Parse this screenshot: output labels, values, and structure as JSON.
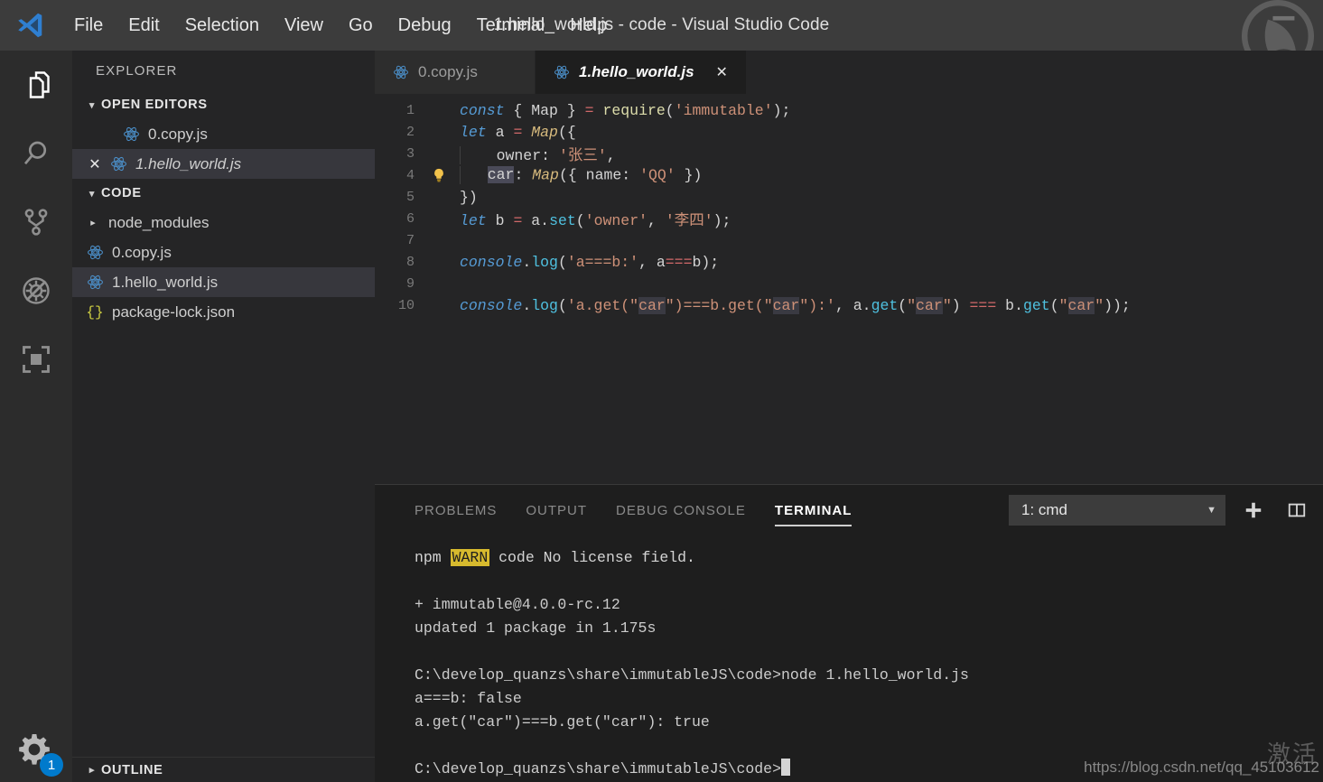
{
  "window": {
    "title": "1.hello_world.js - code - Visual Studio Code",
    "logo_icon": "vscode-logo-icon"
  },
  "menubar": {
    "items": [
      {
        "label": "File"
      },
      {
        "label": "Edit"
      },
      {
        "label": "Selection"
      },
      {
        "label": "View"
      },
      {
        "label": "Go"
      },
      {
        "label": "Debug"
      },
      {
        "label": "Terminal"
      },
      {
        "label": "Help"
      }
    ]
  },
  "activitybar": {
    "items": [
      {
        "name": "explorer",
        "icon": "files-icon",
        "active": true
      },
      {
        "name": "search",
        "icon": "search-icon",
        "active": false
      },
      {
        "name": "source-control",
        "icon": "source-control-icon",
        "active": false
      },
      {
        "name": "debug",
        "icon": "debug-no-icon",
        "active": false
      },
      {
        "name": "extensions",
        "icon": "extensions-icon",
        "active": false
      }
    ],
    "manage": {
      "icon": "gear-icon",
      "badge": "1"
    }
  },
  "sidebar": {
    "title": "EXPLORER",
    "open_editors": {
      "label": "OPEN EDITORS",
      "items": [
        {
          "label": "0.copy.js",
          "icon": "js-file-icon",
          "selected": false,
          "has_close": false,
          "italic": false
        },
        {
          "label": "1.hello_world.js",
          "icon": "js-file-icon",
          "selected": true,
          "has_close": true,
          "italic": true
        }
      ]
    },
    "folder": {
      "label": "CODE",
      "items": [
        {
          "label": "node_modules",
          "icon": "folder-arrow-icon",
          "selected": false,
          "kind": "folder"
        },
        {
          "label": "0.copy.js",
          "icon": "js-file-icon",
          "selected": false,
          "kind": "js"
        },
        {
          "label": "1.hello_world.js",
          "icon": "js-file-icon",
          "selected": true,
          "kind": "js"
        },
        {
          "label": "package-lock.json",
          "icon": "json-file-icon",
          "selected": false,
          "kind": "json"
        }
      ]
    },
    "outline": {
      "label": "OUTLINE"
    }
  },
  "editor": {
    "tabs": [
      {
        "label": "0.copy.js",
        "icon": "js-file-icon",
        "active": false,
        "close_icon": ""
      },
      {
        "label": "1.hello_world.js",
        "icon": "js-file-icon",
        "active": true,
        "close_icon": "✕"
      }
    ],
    "line_numbers": [
      "1",
      "2",
      "3",
      "4",
      "5",
      "6",
      "7",
      "8",
      "9",
      "10"
    ],
    "lightbulb_line": 4,
    "lightbulb_icon": "lightbulb-icon",
    "code_lines": [
      "const { Map } = require('immutable');",
      "let a = Map({",
      "    owner: '张三',",
      "    car: Map({ name: 'QQ' })",
      "})",
      "let b = a.set('owner', '李四');",
      "",
      "console.log('a===b:', a===b);",
      "",
      "console.log('a.get(\"car\")===b.get(\"car\"):', a.get(\"car\") === b.get(\"car\"));"
    ]
  },
  "panel": {
    "tabs": [
      {
        "label": "PROBLEMS",
        "active": false
      },
      {
        "label": "OUTPUT",
        "active": false
      },
      {
        "label": "DEBUG CONSOLE",
        "active": false
      },
      {
        "label": "TERMINAL",
        "active": true
      }
    ],
    "terminal_select": {
      "value": "1: cmd",
      "chevron": "▼"
    },
    "actions": [
      {
        "name": "new-terminal",
        "icon": "plus-icon",
        "glyph": "+"
      },
      {
        "name": "split-terminal",
        "icon": "split-panel-icon",
        "glyph": "◫"
      }
    ],
    "terminal_lines": [
      "npm WARN code No license field.",
      "",
      "+ immutable@4.0.0-rc.12",
      "updated 1 package in 1.175s",
      "",
      "C:\\develop_quanzs\\share\\immutableJS\\code>node 1.hello_world.js",
      "a===b: false",
      "a.get(\"car\")===b.get(\"car\"): true",
      "",
      "C:\\develop_quanzs\\share\\immutableJS\\code>"
    ],
    "warn_token": "WARN"
  },
  "watermark": {
    "url": "https://blog.csdn.net/qq_45103612",
    "cn_text": "激活"
  },
  "colors": {
    "titlebar_bg": "#3c3c3c",
    "activitybar_bg": "#2c2c2c",
    "sidebar_bg": "#252526",
    "editor_bg": "#252526",
    "panel_bg": "#1e1e1e",
    "accent": "#007acc",
    "selected_row": "#37373d",
    "keyword": "#569cd6",
    "string": "#ce9178",
    "type": "#d7ba7d",
    "operator": "#d16969",
    "function": "#4fc1e0",
    "warn_bg": "#d7ba2e"
  }
}
